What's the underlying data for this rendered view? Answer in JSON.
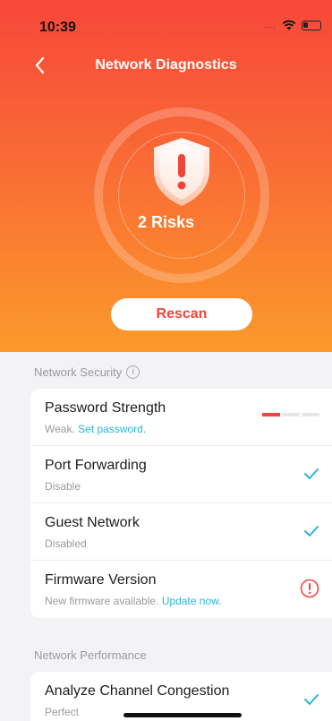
{
  "status_bar": {
    "time": "10:39",
    "dots": "...."
  },
  "nav": {
    "title": "Network Diagnostics"
  },
  "summary": {
    "risks_label": "2 Risks"
  },
  "actions": {
    "rescan_label": "Rescan"
  },
  "network_security": {
    "header": "Network Security",
    "info_glyph": "i",
    "items": [
      {
        "title": "Password Strength",
        "subtitle": "Weak.",
        "link": "Set password.",
        "status": "strength",
        "strength_level": 1,
        "strength_max": 3
      },
      {
        "title": "Port Forwarding",
        "subtitle": "Disable",
        "status": "check"
      },
      {
        "title": "Guest Network",
        "subtitle": "Disabled",
        "status": "check"
      },
      {
        "title": "Firmware Version",
        "subtitle": "New firmware available.",
        "link": "Update now.",
        "status": "alert"
      }
    ]
  },
  "network_performance": {
    "header": "Network Performance",
    "items": [
      {
        "title": "Analyze Channel Congestion",
        "subtitle": "Perfect",
        "status": "check"
      }
    ]
  },
  "colors": {
    "hero_top": "#f7473a",
    "hero_bottom": "#fb9a2b",
    "danger": "#f1453b",
    "link": "#2ab5d6",
    "check": "#2ab5d6"
  },
  "icons": {
    "back": "chevron-left-icon",
    "shield": "shield-alert-icon",
    "info": "info-icon",
    "check": "checkmark-icon",
    "alert": "alert-circle-icon",
    "wifi": "wifi-icon",
    "battery": "battery-icon"
  }
}
